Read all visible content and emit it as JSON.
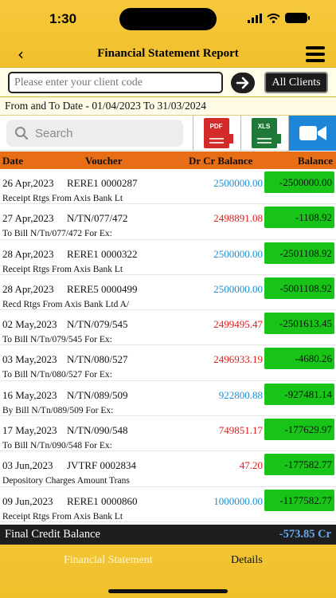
{
  "status": {
    "time": "1:30"
  },
  "header": {
    "title": "Financial Statement Report"
  },
  "client": {
    "placeholder": "Please enter your client code",
    "all_clients_label": "All Clients"
  },
  "date_range": "From and To Date - 01/04/2023 To 31/03/2024",
  "search": {
    "placeholder": "Search"
  },
  "export": {
    "pdf_label": "PDF",
    "xls_label": "XLS"
  },
  "columns": {
    "date": "Date",
    "voucher": "Voucher",
    "drcr": "Dr Cr Balance",
    "balance": "Balance"
  },
  "colors": {
    "credit": "#1f8fd1",
    "debit": "#e01b1b",
    "balance_bg": "#18c418",
    "header_orange": "#e86d17",
    "accent_yellow": "#f3c533"
  },
  "rows": [
    {
      "date": "26 Apr,2023",
      "voucher": "RERE1  0000287",
      "amount": "2500000.00",
      "type": "credit",
      "balance": "-2500000.00",
      "narration": "Receipt Rtgs  From Axis Bank Lt"
    },
    {
      "date": "27 Apr,2023",
      "voucher": "N/TN/077/472",
      "amount": "2498891.08",
      "type": "debit",
      "balance": "-1108.92",
      "narration": "To Bill N/Tn/077/472   For Ex:"
    },
    {
      "date": "28 Apr,2023",
      "voucher": "RERE1  0000322",
      "amount": "2500000.00",
      "type": "credit",
      "balance": "-2501108.92",
      "narration": "Receipt Rtgs  From Axis Bank Lt"
    },
    {
      "date": "28 Apr,2023",
      "voucher": "RERE5  0000499",
      "amount": "2500000.00",
      "type": "credit",
      "balance": "-5001108.92",
      "narration": "Recd Rtgs From Axis Bank Ltd A/"
    },
    {
      "date": "02 May,2023",
      "voucher": "N/TN/079/545",
      "amount": "2499495.47",
      "type": "debit",
      "balance": "-2501613.45",
      "narration": "To Bill N/Tn/079/545   For Ex:"
    },
    {
      "date": "03 May,2023",
      "voucher": "N/TN/080/527",
      "amount": "2496933.19",
      "type": "debit",
      "balance": "-4680.26",
      "narration": "To Bill N/Tn/080/527   For Ex:"
    },
    {
      "date": "16 May,2023",
      "voucher": "N/TN/089/509",
      "amount": "922800.88",
      "type": "credit",
      "balance": "-927481.14",
      "narration": "By Bill N/Tn/089/509   For Ex:"
    },
    {
      "date": "17 May,2023",
      "voucher": "N/TN/090/548",
      "amount": "749851.17",
      "type": "debit",
      "balance": "-177629.97",
      "narration": "To Bill N/Tn/090/548   For Ex:"
    },
    {
      "date": "03 Jun,2023",
      "voucher": "JVTRF   0002834",
      "amount": "47.20",
      "type": "debit",
      "balance": "-177582.77",
      "narration": "Depository Charges Amount Trans"
    },
    {
      "date": "09 Jun,2023",
      "voucher": "RERE1  0000860",
      "amount": "1000000.00",
      "type": "credit",
      "balance": "-1177582.77",
      "narration": "Receipt Rtgs  From Axis Bank Lt"
    }
  ],
  "final": {
    "label": "Final Credit Balance",
    "value": "-573.85 Cr"
  },
  "tabs": {
    "statement": "Financial Statement",
    "details": "Details"
  }
}
